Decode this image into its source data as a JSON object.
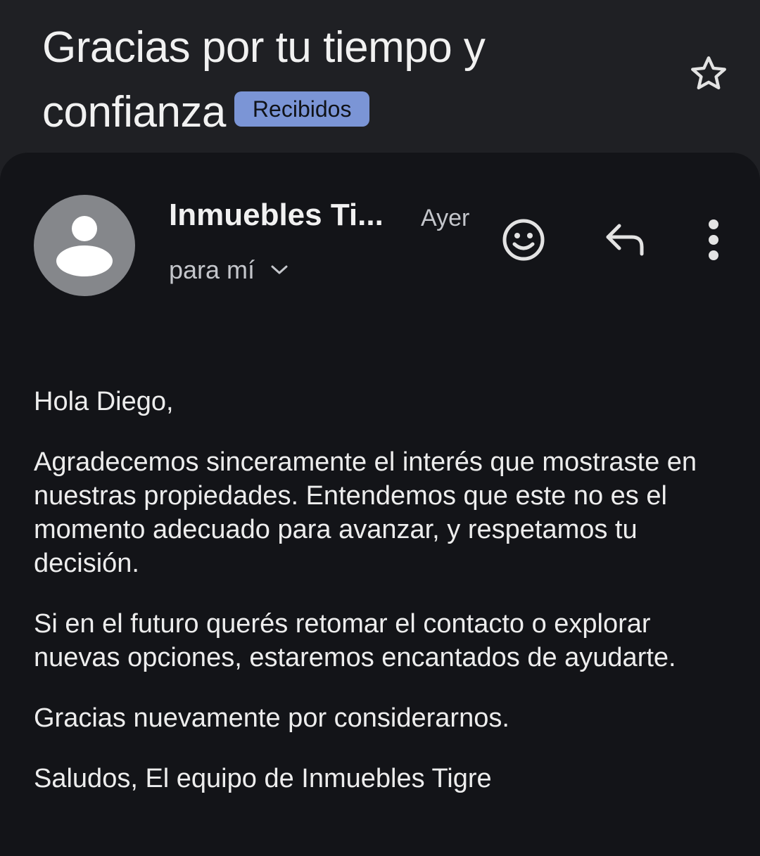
{
  "email": {
    "subject": "Gracias por tu tiempo y confianza",
    "label_badge": "Recibidos",
    "sender": "Inmuebles Ti...",
    "date": "Ayer",
    "recipient_line": "para mí",
    "body": {
      "greeting": "Hola Diego,",
      "paragraph1": "Agradecemos sinceramente el interés que mostraste en nuestras propiedades. Entendemos que este no es el momento adecuado para avanzar, y respetamos tu decisión.",
      "paragraph2": "Si en el futuro querés retomar el contacto o explorar nuevas opciones, estaremos encantados de ayudarte.",
      "paragraph3": "Gracias nuevamente por considerarnos.",
      "signature": "Saludos, El equipo de Inmuebles Tigre"
    }
  },
  "icons": {
    "star": "star-icon",
    "avatar": "person-avatar-icon",
    "chevron": "chevron-down-icon",
    "emoji": "emoji-reaction-icon",
    "reply": "reply-icon",
    "more": "more-vert-icon"
  },
  "colors": {
    "background": "#1f2024",
    "card": "#131418",
    "badge": "#7b95d6",
    "avatar": "#85878b"
  }
}
